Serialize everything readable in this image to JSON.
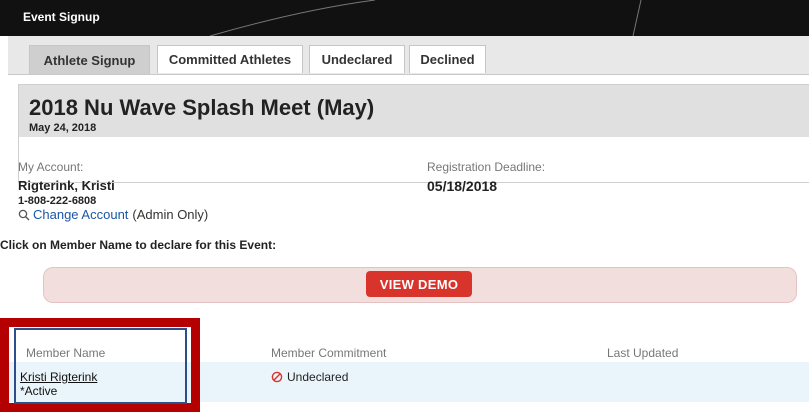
{
  "window": {
    "title": "Event Signup"
  },
  "tabs": [
    {
      "label": "Athlete Signup",
      "active": true
    },
    {
      "label": "Committed Athletes",
      "active": false
    },
    {
      "label": "Undeclared",
      "active": false
    },
    {
      "label": "Declined",
      "active": false
    }
  ],
  "event": {
    "title": "2018 Nu Wave Splash Meet (May)",
    "date": "May 24, 2018"
  },
  "account": {
    "label": "My Account:",
    "name": "Rigterink, Kristi",
    "phone": "1-808-222-6808",
    "change_link": "Change Account",
    "admin_note": "(Admin Only)"
  },
  "deadline": {
    "label": "Registration Deadline:",
    "value": "05/18/2018"
  },
  "instruction": "Click on Member Name to declare for this Event:",
  "demo_button": "VIEW DEMO",
  "table": {
    "columns": [
      "Member Name",
      "Member Commitment",
      "Last Updated"
    ],
    "rows": [
      {
        "name": "Kristi Rigterink",
        "status": "*Active",
        "commitment": "Undeclared",
        "last_updated": ""
      }
    ]
  },
  "colors": {
    "topbar": "#111111",
    "demo_button": "#d9342b",
    "demo_band": "#f3dede",
    "row_highlight": "#eaf5fb",
    "annotation_red": "#b40000",
    "annotation_blue": "#2c4f8c",
    "link": "#1a56a6"
  },
  "icons": {
    "change_account": "search-icon",
    "undeclared": "no-entry-icon"
  }
}
